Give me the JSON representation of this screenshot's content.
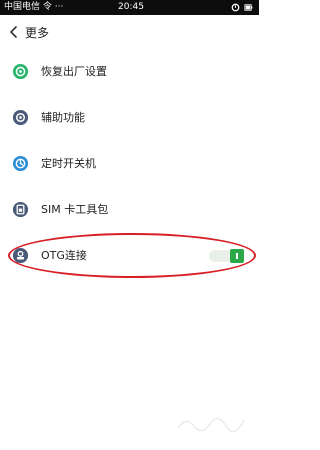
{
  "status_bar": {
    "carrier": "中国电信 令 ···",
    "time": "20:45"
  },
  "header": {
    "back_icon": "chevron-left-icon",
    "title": "更多"
  },
  "settings": {
    "items": [
      {
        "label": "恢复出厂设置",
        "icon": "restore-icon",
        "icon_color": "#2bb56e"
      },
      {
        "label": "辅助功能",
        "icon": "accessibility-icon",
        "icon_color": "#4a5a78"
      },
      {
        "label": "定时开关机",
        "icon": "power-timer-icon",
        "icon_color": "#2e8fd6"
      },
      {
        "label": "SIM 卡工具包",
        "icon": "sim-card-icon",
        "icon_color": "#4a5a78"
      },
      {
        "label": "OTG连接",
        "icon": "otg-icon",
        "icon_color": "#4a5a78",
        "toggle_on": true
      }
    ]
  },
  "colors": {
    "toggle_on": "#2aa84a",
    "highlight": "#d81f26",
    "status_bar_bg": "#0d0d0d"
  }
}
